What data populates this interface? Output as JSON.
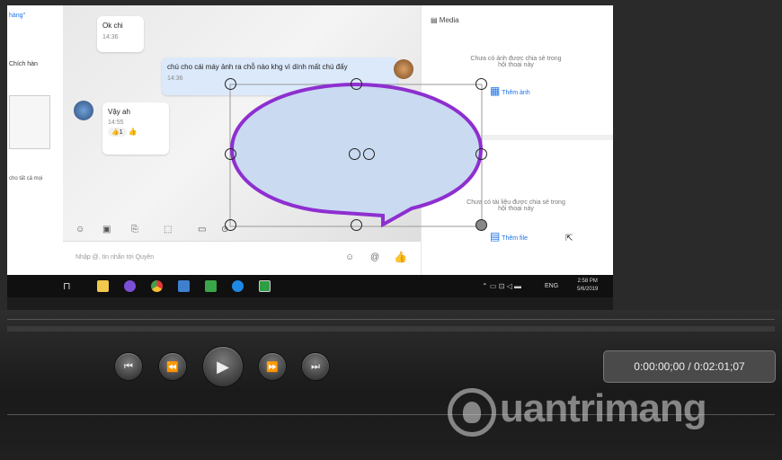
{
  "chat_app": {
    "left_panel": {
      "top_text": "hàng\"",
      "mid_text": "Chích hàn",
      "bottom_text": "cho tất cả mọi"
    },
    "messages": [
      {
        "text": "Ok chi",
        "time": "14:36"
      },
      {
        "text": "chú cho cái máy ảnh ra chỗ nào khg vì dính mất chú đấy",
        "time": "14:36"
      },
      {
        "text": "Vậy ah",
        "time": "14:55",
        "reaction": "1"
      }
    ],
    "input_placeholder": "Nhập @, tin nhắn tới Quyên",
    "media_panel": {
      "header": "Media",
      "empty_images": "Chưa có ảnh được chia sẻ trong hội thoại này",
      "add_image": "Thêm ảnh",
      "empty_files": "Chưa có tài liệu được chia sẻ trong hội thoại này",
      "add_file": "Thêm file"
    }
  },
  "taskbar": {
    "language": "ENG",
    "clock_time": "2:58 PM",
    "clock_date": "5/6/2019"
  },
  "player": {
    "timecode": "0:00:00;00 / 0:02:01;07"
  },
  "watermark": {
    "text": "uantrimang"
  },
  "colors": {
    "callout_fill": "#c9daf1",
    "callout_stroke": "#8e2fd0",
    "controls_bg": "#1c1c1c",
    "link_blue": "#1a73e8"
  }
}
